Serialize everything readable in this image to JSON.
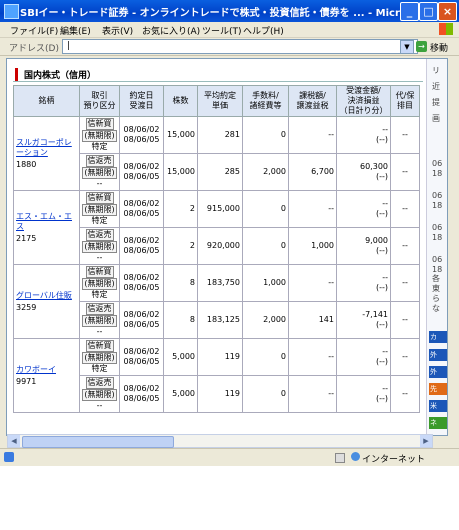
{
  "window": {
    "title": "SBIイー・トレード証券 - オンライントレードで株式・投資信託・債券を ... - Microsoft Intern..."
  },
  "menu": [
    "ファイル(F)",
    "編集(E)",
    "表示(V)",
    "お気に入り(A)",
    "ツール(T)",
    "ヘルプ(H)"
  ],
  "address": {
    "label": "アドレス(D)",
    "value": "|",
    "go": "移動"
  },
  "section_title": "国内株式（信用）",
  "headers": {
    "c1": "銘柄",
    "c2a": "取引",
    "c2b": "預り区分",
    "c3a": "約定日",
    "c3b": "受渡日",
    "c4": "株数",
    "c5a": "平均約定",
    "c5b": "単価",
    "c6a": "手数料/",
    "c6b": "諸経費等",
    "c7a": "課税額/",
    "c7b": "譲渡益税",
    "c8a": "受渡金額/",
    "c8b": "決済損益",
    "c8c": "（日計り分）",
    "c9a": "代/保",
    "c9b": "排目"
  },
  "stocks": [
    {
      "name": "スルガコーポレーション",
      "code": "1880",
      "rows": [
        {
          "t1": "信新買",
          "t2": "(無期限)",
          "t3": "特定",
          "d1": "08/06/02",
          "d2": "08/06/05",
          "shares": "15,000",
          "price": "281",
          "fee": "0",
          "tax": "--",
          "amt1": "--",
          "amt2": "(--)",
          "last": "--"
        },
        {
          "t1": "信返売",
          "t2": "(無期限)",
          "t3": "--",
          "d1": "08/06/02",
          "d2": "08/06/05",
          "shares": "15,000",
          "price": "285",
          "fee": "2,000",
          "tax": "6,700",
          "amt1": "60,300",
          "amt2": "(--)",
          "last": "--"
        }
      ]
    },
    {
      "name": "エス・エム・エス",
      "code": "2175",
      "rows": [
        {
          "t1": "信新買",
          "t2": "(無期限)",
          "t3": "特定",
          "d1": "08/06/02",
          "d2": "08/06/05",
          "shares": "2",
          "price": "915,000",
          "fee": "0",
          "tax": "--",
          "amt1": "--",
          "amt2": "(--)",
          "last": "--"
        },
        {
          "t1": "信返売",
          "t2": "(無期限)",
          "t3": "--",
          "d1": "08/06/02",
          "d2": "08/06/05",
          "shares": "2",
          "price": "920,000",
          "fee": "0",
          "tax": "1,000",
          "amt1": "9,000",
          "amt2": "(--)",
          "last": "--"
        }
      ]
    },
    {
      "name": "グローバル住販",
      "code": "3259",
      "rows": [
        {
          "t1": "信新買",
          "t2": "(無期限)",
          "t3": "特定",
          "d1": "08/06/02",
          "d2": "08/06/05",
          "shares": "8",
          "price": "183,750",
          "fee": "1,000",
          "tax": "--",
          "amt1": "--",
          "amt2": "(--)",
          "last": "--"
        },
        {
          "t1": "信返売",
          "t2": "(無期限)",
          "t3": "--",
          "d1": "08/06/02",
          "d2": "08/06/05",
          "shares": "8",
          "price": "183,125",
          "fee": "2,000",
          "tax": "141",
          "amt1": "-7,141",
          "amt2": "(--)",
          "last": "--"
        }
      ]
    },
    {
      "name": "カワボーイ",
      "code": "9971",
      "rows": [
        {
          "t1": "信新買",
          "t2": "(無期限)",
          "t3": "特定",
          "d1": "08/06/02",
          "d2": "08/06/05",
          "shares": "5,000",
          "price": "119",
          "fee": "0",
          "tax": "--",
          "amt1": "--",
          "amt2": "(--)",
          "last": "--"
        },
        {
          "t1": "信返売",
          "t2": "(無期限)",
          "t3": "--",
          "d1": "08/06/02",
          "d2": "08/06/05",
          "shares": "5,000",
          "price": "119",
          "fee": "0",
          "tax": "--",
          "amt1": "--",
          "amt2": "(--)",
          "last": "--"
        }
      ]
    }
  ],
  "sidebar": {
    "texts": [
      "リ",
      "近",
      "提",
      "画",
      "06",
      "18",
      "06",
      "18",
      "06",
      "18",
      "06",
      "18",
      "各",
      "東",
      "ら",
      "な"
    ],
    "buttons": [
      {
        "label": "カ",
        "color": "#1c57b8"
      },
      {
        "label": "外",
        "color": "#1c57b8"
      },
      {
        "label": "外",
        "color": "#1c57b8"
      },
      {
        "label": "先",
        "color": "#e06a17"
      },
      {
        "label": "米",
        "color": "#1c57b8"
      },
      {
        "label": "ネ",
        "color": "#3a9a2a"
      }
    ]
  },
  "status": {
    "zone": "インターネット"
  }
}
